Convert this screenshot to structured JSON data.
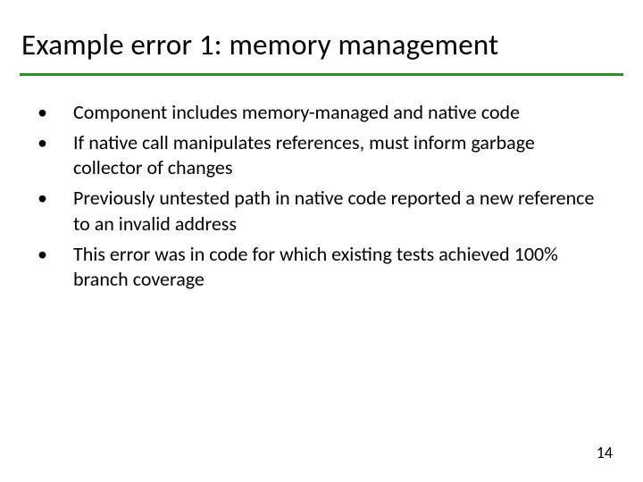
{
  "slide": {
    "title": "Example error 1: memory management",
    "bullets": [
      "Component includes memory-managed and native code",
      "If native call manipulates references, must inform garbage collector of changes",
      " Previously untested path in native code reported a new reference to an invalid address",
      "This error was in code for which existing tests achieved 100% branch coverage"
    ],
    "page_number": "14"
  },
  "glyphs": {
    "bullet": "•"
  },
  "colors": {
    "rule": "#2e8b2e"
  }
}
